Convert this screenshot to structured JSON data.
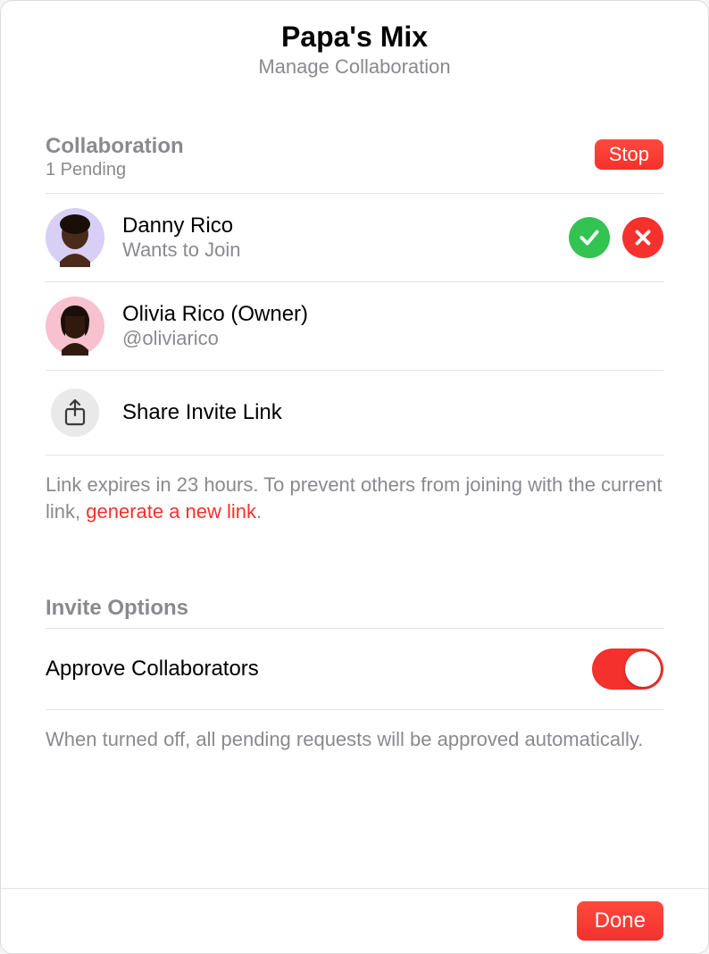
{
  "header": {
    "title": "Papa's Mix",
    "subtitle": "Manage Collaboration"
  },
  "collaboration": {
    "section_title": "Collaboration",
    "pending_text": "1 Pending",
    "stop_label": "Stop",
    "members": [
      {
        "name": "Danny Rico",
        "detail": "Wants to Join",
        "avatar_bg": "#d7cff6",
        "face": "#4a2b1a",
        "has_actions": true
      },
      {
        "name": "Olivia Rico (Owner)",
        "detail": "@oliviarico",
        "avatar_bg": "#f7c1cf",
        "face": "#2f1a0d",
        "has_actions": false
      }
    ],
    "share_link_label": "Share Invite Link",
    "info_prefix": "Link expires in 23 hours. To prevent others from joining with the current link, ",
    "info_link": "generate a new link",
    "info_suffix": "."
  },
  "invite_options": {
    "section_title": "Invite Options",
    "toggle_label": "Approve Collaborators",
    "toggle_on": true,
    "help_text": "When turned off, all pending requests will be approved automatically."
  },
  "footer": {
    "done_label": "Done"
  }
}
